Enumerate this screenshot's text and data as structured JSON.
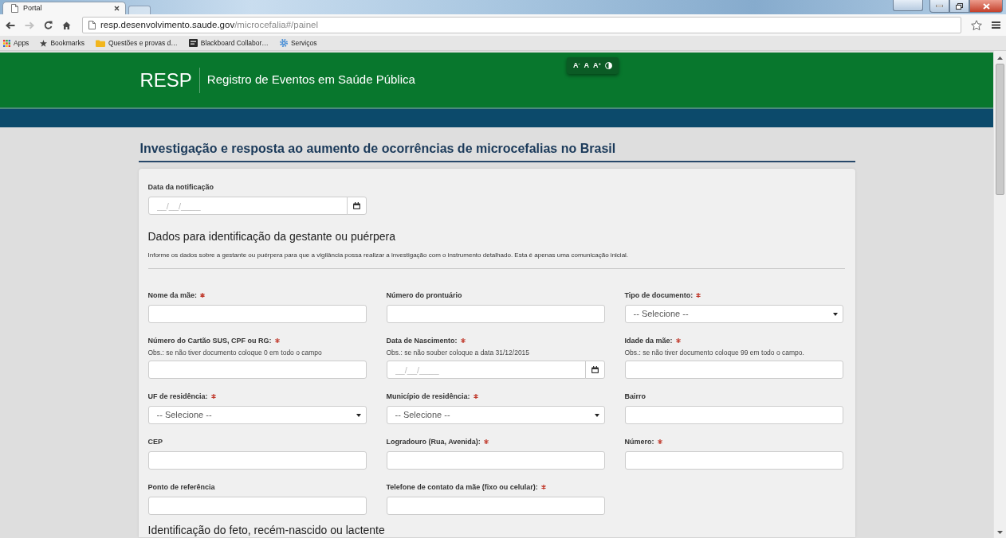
{
  "browser": {
    "tabs": [
      {
        "title": "Portal",
        "selected": true
      }
    ],
    "toolbar": [
      {
        "kind": "back",
        "disabled": false
      },
      {
        "kind": "forward",
        "disabled": true
      },
      {
        "kind": "reload",
        "disabled": false
      },
      {
        "kind": "home",
        "disabled": false
      }
    ],
    "address": {
      "host": "resp.desenvolvimento.saude.gov",
      "path": "/microcefalia#/painel"
    },
    "bookmarks": [
      {
        "kind": "apps",
        "label": "Apps"
      },
      {
        "kind": "star",
        "label": "Bookmarks"
      },
      {
        "kind": "folder",
        "label": "Questões e provas d…"
      },
      {
        "kind": "board",
        "label": "Blackboard Collabor…"
      },
      {
        "kind": "gear",
        "label": "Serviços"
      }
    ]
  },
  "header": {
    "logo": "RESP",
    "subtitle": "Registro de Eventos em Saúde Pública",
    "font_controls": [
      {
        "kind": "text",
        "label": "A$^{-}$"
      },
      {
        "kind": "text",
        "label": "A"
      },
      {
        "kind": "text",
        "label": "A$^{+}$"
      },
      {
        "kind": "contrast"
      }
    ]
  },
  "page_title": "Investigação e resposta ao aumento de ocorrências de microcefalias no Brasil",
  "form": {
    "fields": [
      {
        "label": "Data da notificação",
        "kind": "date",
        "required": false,
        "placeholder": "__/__/____"
      }
    ],
    "sections": [
      {
        "title": "Dados para identificação da gestante ou puérpera",
        "description": "Informe os dados sobre a gestante ou puérpera para que a vigilância possa realizar a investigação com o instrumento detalhado. Esta é apenas uma comunicação inicial.",
        "rows": [
          [
            {
              "label": "Nome da mãe:",
              "kind": "text",
              "required": true
            },
            {
              "label": "Número do prontuário",
              "kind": "text",
              "required": false
            },
            {
              "label": "Tipo de documento:",
              "kind": "select",
              "required": true,
              "value": "-- Selecione --"
            }
          ],
          [
            {
              "label": "Número do Cartão SUS, CPF ou RG:",
              "kind": "text",
              "required": true,
              "hint": "Obs.: se não tiver documento coloque 0 em todo o campo"
            },
            {
              "label": "Data de Nascimento:",
              "kind": "date",
              "required": true,
              "hint": "Obs.: se não souber coloque a data 31/12/2015",
              "placeholder": "__/__/____"
            },
            {
              "label": "Idade da mãe:",
              "kind": "text",
              "required": true,
              "hint": "Obs.: se não tiver documento coloque 99 em todo o campo."
            }
          ],
          [
            {
              "label": "UF de residência:",
              "kind": "select",
              "required": true,
              "value": "-- Selecione --"
            },
            {
              "label": "Município de residência:",
              "kind": "select",
              "required": true,
              "value": "-- Selecione --"
            },
            {
              "label": "Bairro",
              "kind": "text",
              "required": false
            }
          ],
          [
            {
              "label": "CEP",
              "kind": "text",
              "required": false
            },
            {
              "label": "Logradouro (Rua, Avenida):",
              "kind": "text",
              "required": true
            },
            {
              "label": "Número:",
              "kind": "text",
              "required": true
            }
          ],
          [
            {
              "label": "Ponto de referência",
              "kind": "text",
              "required": false
            },
            {
              "label": "Telefone de contato da mãe (fixo ou celular):",
              "kind": "text",
              "required": true
            }
          ]
        ]
      },
      {
        "title": "Identificação do feto, recém-nascido ou lactente"
      }
    ]
  }
}
